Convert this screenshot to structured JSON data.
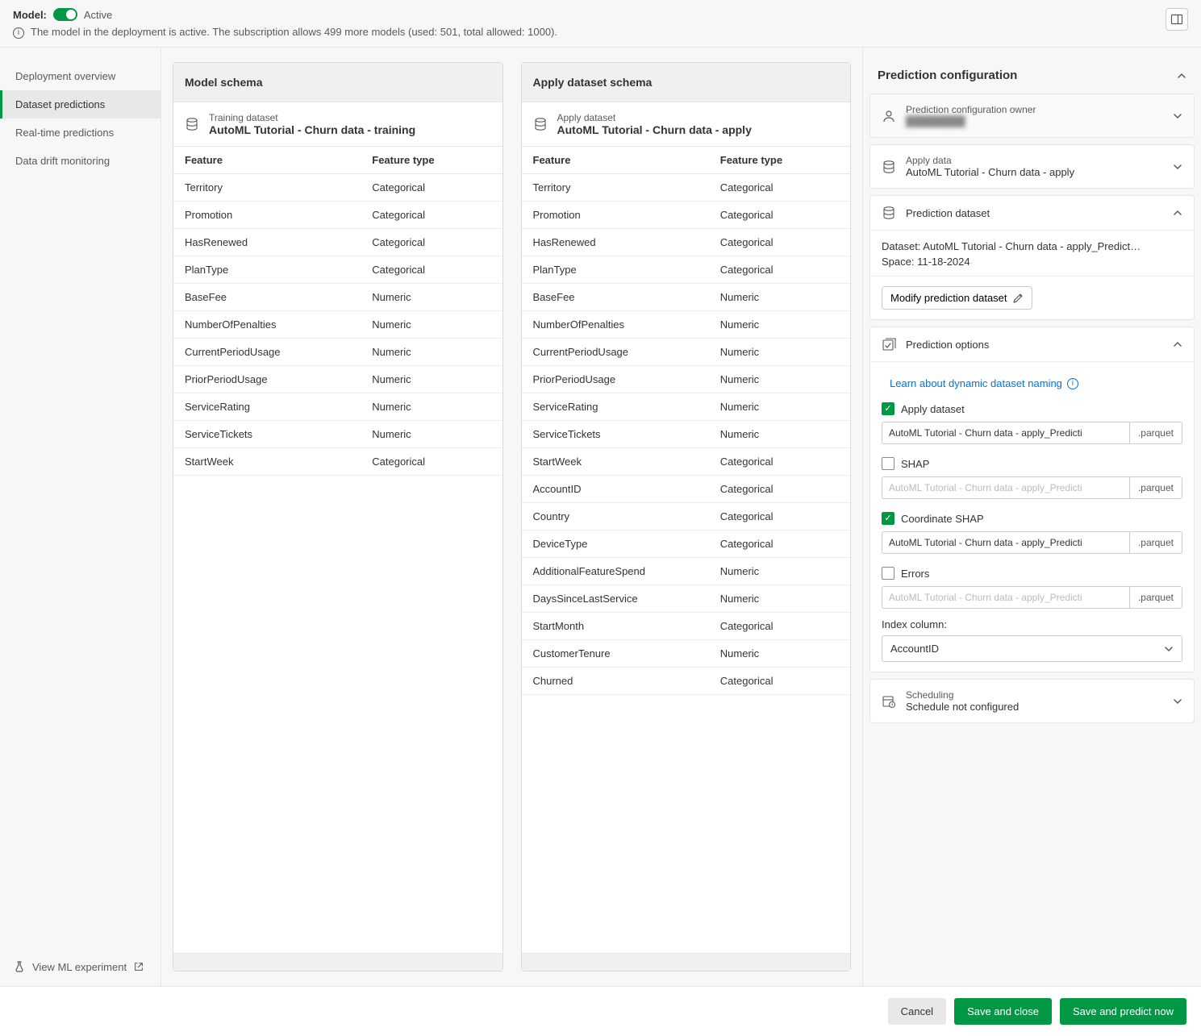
{
  "banner": {
    "model_label": "Model:",
    "status_text": "Active",
    "status_on": true,
    "info_text": "The model in the deployment is active. The subscription allows 499 more models (used: 501, total allowed: 1000)."
  },
  "sidebar": {
    "items": [
      {
        "label": "Deployment overview",
        "active": false
      },
      {
        "label": "Dataset predictions",
        "active": true
      },
      {
        "label": "Real-time predictions",
        "active": false
      },
      {
        "label": "Data drift monitoring",
        "active": false
      }
    ],
    "footer_label": "View ML experiment"
  },
  "model_schema": {
    "title": "Model schema",
    "dataset_label": "Training dataset",
    "dataset_name": "AutoML Tutorial - Churn data - training",
    "headers": {
      "feature": "Feature",
      "type": "Feature type"
    },
    "rows": [
      {
        "feature": "Territory",
        "type": "Categorical"
      },
      {
        "feature": "Promotion",
        "type": "Categorical"
      },
      {
        "feature": "HasRenewed",
        "type": "Categorical"
      },
      {
        "feature": "PlanType",
        "type": "Categorical"
      },
      {
        "feature": "BaseFee",
        "type": "Numeric"
      },
      {
        "feature": "NumberOfPenalties",
        "type": "Numeric"
      },
      {
        "feature": "CurrentPeriodUsage",
        "type": "Numeric"
      },
      {
        "feature": "PriorPeriodUsage",
        "type": "Numeric"
      },
      {
        "feature": "ServiceRating",
        "type": "Numeric"
      },
      {
        "feature": "ServiceTickets",
        "type": "Numeric"
      },
      {
        "feature": "StartWeek",
        "type": "Categorical"
      }
    ]
  },
  "apply_schema": {
    "title": "Apply dataset schema",
    "dataset_label": "Apply dataset",
    "dataset_name": "AutoML Tutorial - Churn data - apply",
    "headers": {
      "feature": "Feature",
      "type": "Feature type"
    },
    "rows": [
      {
        "feature": "Territory",
        "type": "Categorical"
      },
      {
        "feature": "Promotion",
        "type": "Categorical"
      },
      {
        "feature": "HasRenewed",
        "type": "Categorical"
      },
      {
        "feature": "PlanType",
        "type": "Categorical"
      },
      {
        "feature": "BaseFee",
        "type": "Numeric"
      },
      {
        "feature": "NumberOfPenalties",
        "type": "Numeric"
      },
      {
        "feature": "CurrentPeriodUsage",
        "type": "Numeric"
      },
      {
        "feature": "PriorPeriodUsage",
        "type": "Numeric"
      },
      {
        "feature": "ServiceRating",
        "type": "Numeric"
      },
      {
        "feature": "ServiceTickets",
        "type": "Numeric"
      },
      {
        "feature": "StartWeek",
        "type": "Categorical"
      },
      {
        "feature": "AccountID",
        "type": "Categorical"
      },
      {
        "feature": "Country",
        "type": "Categorical"
      },
      {
        "feature": "DeviceType",
        "type": "Categorical"
      },
      {
        "feature": "AdditionalFeatureSpend",
        "type": "Numeric"
      },
      {
        "feature": "DaysSinceLastService",
        "type": "Numeric"
      },
      {
        "feature": "StartMonth",
        "type": "Categorical"
      },
      {
        "feature": "CustomerTenure",
        "type": "Numeric"
      },
      {
        "feature": "Churned",
        "type": "Categorical"
      }
    ]
  },
  "config": {
    "title": "Prediction configuration",
    "owner": {
      "label": "Prediction configuration owner",
      "value": "████████"
    },
    "apply_data": {
      "label": "Apply data",
      "value": "AutoML Tutorial - Churn data - apply"
    },
    "pred_dataset": {
      "label": "Prediction dataset",
      "dataset_line": "Dataset: AutoML Tutorial - Churn data - apply_Predict…",
      "space_line": "Space: 11-18-2024",
      "modify_btn": "Modify prediction dataset"
    },
    "options": {
      "label": "Prediction options",
      "learn_link": "Learn about dynamic dataset naming",
      "opts": [
        {
          "label": "Apply dataset",
          "checked": true,
          "value": "AutoML Tutorial - Churn data - apply_Predicti",
          "ext": ".parquet"
        },
        {
          "label": "SHAP",
          "checked": false,
          "value": "AutoML Tutorial - Churn data - apply_Predicti",
          "ext": ".parquet"
        },
        {
          "label": "Coordinate SHAP",
          "checked": true,
          "value": "AutoML Tutorial - Churn data - apply_Predicti",
          "ext": ".parquet"
        },
        {
          "label": "Errors",
          "checked": false,
          "value": "AutoML Tutorial - Churn data - apply_Predicti",
          "ext": ".parquet"
        }
      ],
      "index_label": "Index column:",
      "index_value": "AccountID"
    },
    "scheduling": {
      "label": "Scheduling",
      "value": "Schedule not configured"
    }
  },
  "footer": {
    "cancel": "Cancel",
    "save_close": "Save and close",
    "save_predict": "Save and predict now"
  }
}
